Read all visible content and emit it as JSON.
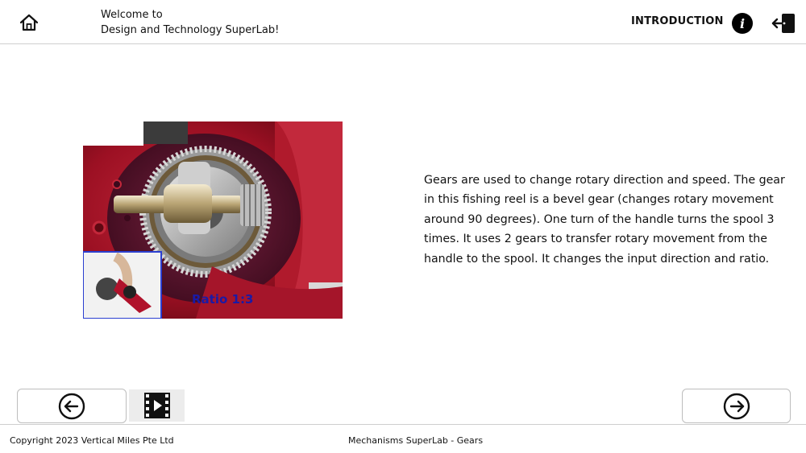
{
  "header": {
    "welcome_line1": "Welcome to",
    "welcome_line2": "Design and Technology SuperLab!",
    "section_title": "INTRODUCTION",
    "info_glyph": "i",
    "icons": {
      "home": "home-icon",
      "info": "info-icon",
      "exit": "exit-icon"
    }
  },
  "content": {
    "image_label": "Ratio 1:3",
    "description": "Gears are used to change rotary direction and speed. The gear in this fishing reel is a bevel gear (changes rotary movement around 90 degrees). One turn of the handle turns the spool 3 times. It uses 2 gears to transfer rotary movement from the handle to the spool. It changes the input direction and ratio."
  },
  "nav": {
    "prev_icon": "arrow-left-circle-icon",
    "next_icon": "arrow-right-circle-icon",
    "video_icon": "video-film-icon"
  },
  "footer": {
    "copyright": "Copyright 2023 Vertical Miles Pte Ltd",
    "lab_name": "Mechanisms SuperLab - Gears"
  },
  "colors": {
    "reel_red": "#9c1023",
    "label_blue": "#1a1aa6",
    "border_gray": "#cfcfcf"
  }
}
